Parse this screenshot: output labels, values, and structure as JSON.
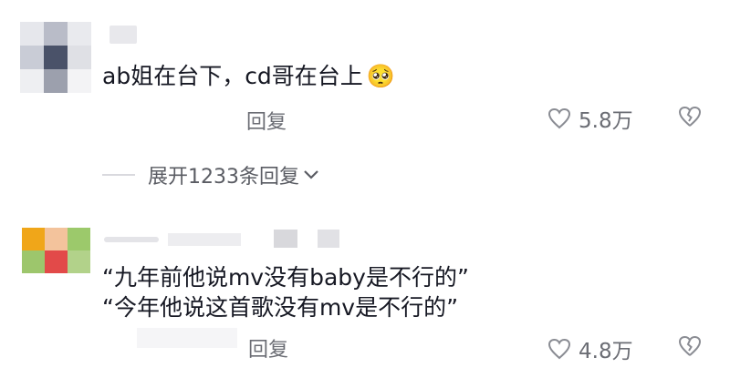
{
  "comments": [
    {
      "text": "ab姐在台下，cd哥在台上",
      "emoji": "🥺",
      "reply_label": "回复",
      "likes": "5.8万"
    },
    {
      "text_line1": "“九年前他说mv没有baby是不行的”",
      "text_line2": "“今年他说这首歌没有mv是不行的”",
      "reply_label": "回复",
      "likes": "4.8万"
    }
  ],
  "expand_replies": "展开1233条回复",
  "icons": {
    "like": "heart-outline-icon",
    "dislike": "broken-heart-outline-icon",
    "expand": "chevron-down-icon"
  },
  "colors": {
    "text": "#161823",
    "secondary": "#6b6d74"
  }
}
